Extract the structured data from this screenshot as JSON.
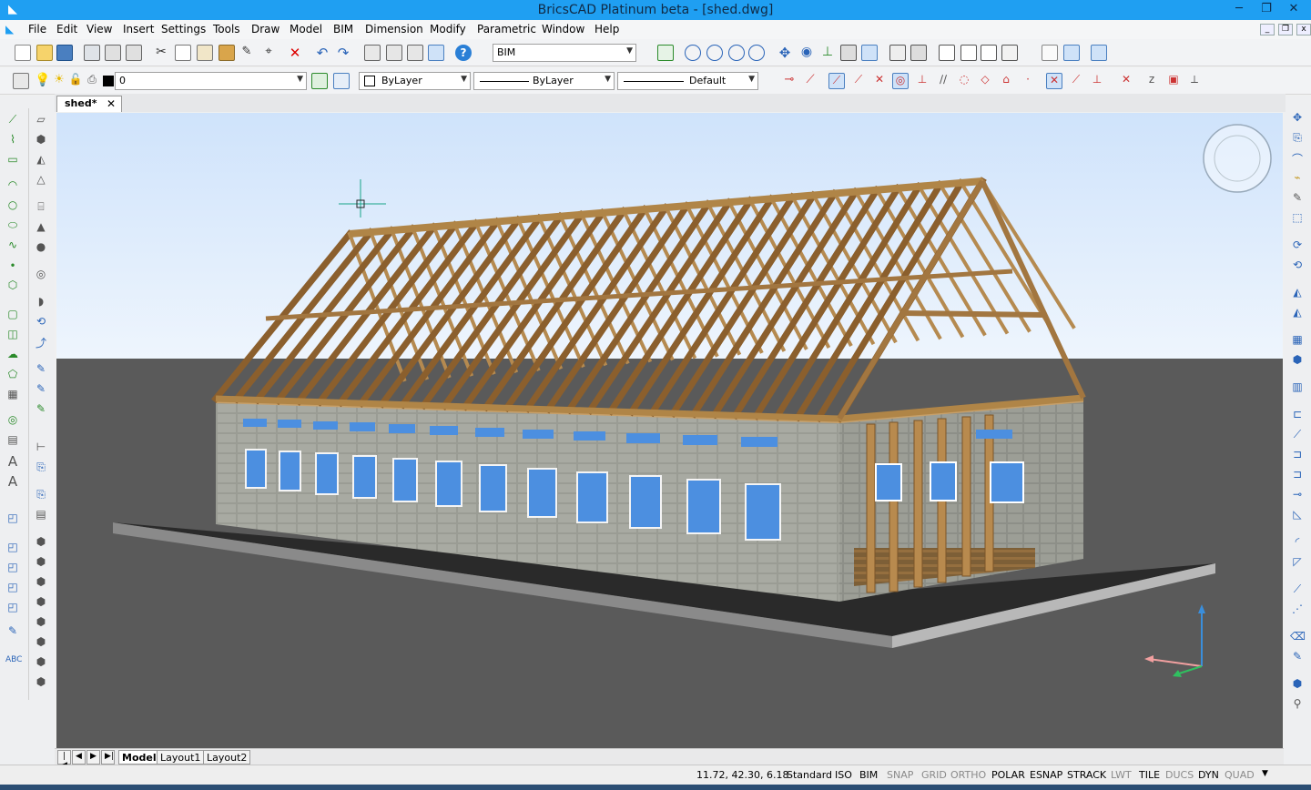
{
  "window": {
    "title": "BricsCAD Platinum beta - [shed.dwg]",
    "minimize": "─",
    "maximize": "❐",
    "close": "✕"
  },
  "menu": [
    "File",
    "Edit",
    "View",
    "Insert",
    "Settings",
    "Tools",
    "Draw",
    "Model",
    "BIM",
    "Dimension",
    "Modify",
    "Parametric",
    "Window",
    "Help"
  ],
  "workspace_combo": {
    "value": "BIM"
  },
  "layer_combo": {
    "value": "0"
  },
  "color_combo": {
    "value": "ByLayer"
  },
  "linetype_combo": {
    "value": "ByLayer"
  },
  "lineweight_combo": {
    "value": "Default"
  },
  "document_tab": {
    "label": "shed*",
    "close": "✕"
  },
  "layout_tabs": {
    "nav": [
      "|◀",
      "◀",
      "▶",
      "▶|"
    ],
    "tabs": [
      "Model",
      "Layout1",
      "Layout2"
    ]
  },
  "status": {
    "coords": "11.72, 42.30, 6.18",
    "items": [
      {
        "label": "Standard",
        "on": true
      },
      {
        "label": "ISO",
        "on": true
      },
      {
        "label": "BIM",
        "on": true
      },
      {
        "label": "SNAP",
        "on": false
      },
      {
        "label": "GRID",
        "on": false
      },
      {
        "label": "ORTHO",
        "on": false
      },
      {
        "label": "POLAR",
        "on": true
      },
      {
        "label": "ESNAP",
        "on": true
      },
      {
        "label": "STRACK",
        "on": true
      },
      {
        "label": "LWT",
        "on": false
      },
      {
        "label": "TILE",
        "on": true
      },
      {
        "label": "DUCS",
        "on": false
      },
      {
        "label": "DYN",
        "on": true
      },
      {
        "label": "QUAD",
        "on": false
      }
    ]
  },
  "colors": {
    "titlebar": "#1f9ff2",
    "sky_top": "#cfe3fb",
    "ground": "#5a5a5a",
    "wood": "#a7773e",
    "wall": "#9a9c94",
    "glass": "#4c8fe0"
  },
  "icons": [
    "new-icon",
    "open-icon",
    "save-icon",
    "print-icon",
    "cut-icon",
    "copy-icon",
    "paste-icon",
    "undo-icon",
    "redo-icon",
    "help-icon",
    "zoom-icon",
    "orbit-icon",
    "layer-icon",
    "navigation-cube-icon",
    "ucs-axes-icon"
  ]
}
